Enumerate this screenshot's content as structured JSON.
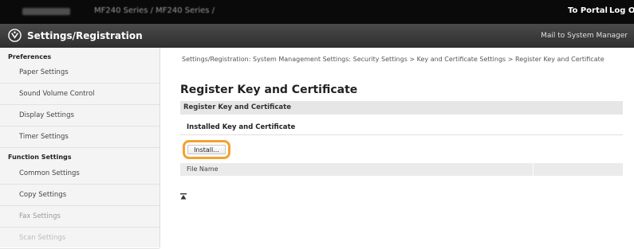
{
  "topbar": {
    "model_text": "MF240 Series / MF240 Series /",
    "to_portal": "To Portal",
    "log_out": "Log Out"
  },
  "header": {
    "title": "Settings/Registration",
    "mail_link": "Mail to System Manager"
  },
  "sidebar": {
    "categories": [
      {
        "label": "Preferences"
      },
      {
        "label": "Function Settings"
      }
    ],
    "items": [
      {
        "label": "Paper Settings"
      },
      {
        "label": "Sound Volume Control"
      },
      {
        "label": "Display Settings"
      },
      {
        "label": "Timer Settings"
      },
      {
        "label": "Common Settings"
      },
      {
        "label": "Copy Settings"
      },
      {
        "label": "Fax Settings"
      },
      {
        "label": "Scan Settings"
      }
    ]
  },
  "main": {
    "breadcrumb": "Settings/Registration: System Management Settings: Security Settings > Key and Certificate Settings > Register Key and Certificate",
    "page_title": "Register Key and Certificate",
    "section_title": "Register Key and Certificate",
    "subsection_title": "Installed Key and Certificate",
    "install_button": "Install...",
    "table_header": "File Name"
  },
  "colors": {
    "highlight": "#f3a230",
    "topbar": "#0a0a0a",
    "header": "#3a3a3a"
  },
  "icons": {
    "logo": "settings-logo-icon",
    "scroll_top": "scroll-to-top-icon"
  }
}
